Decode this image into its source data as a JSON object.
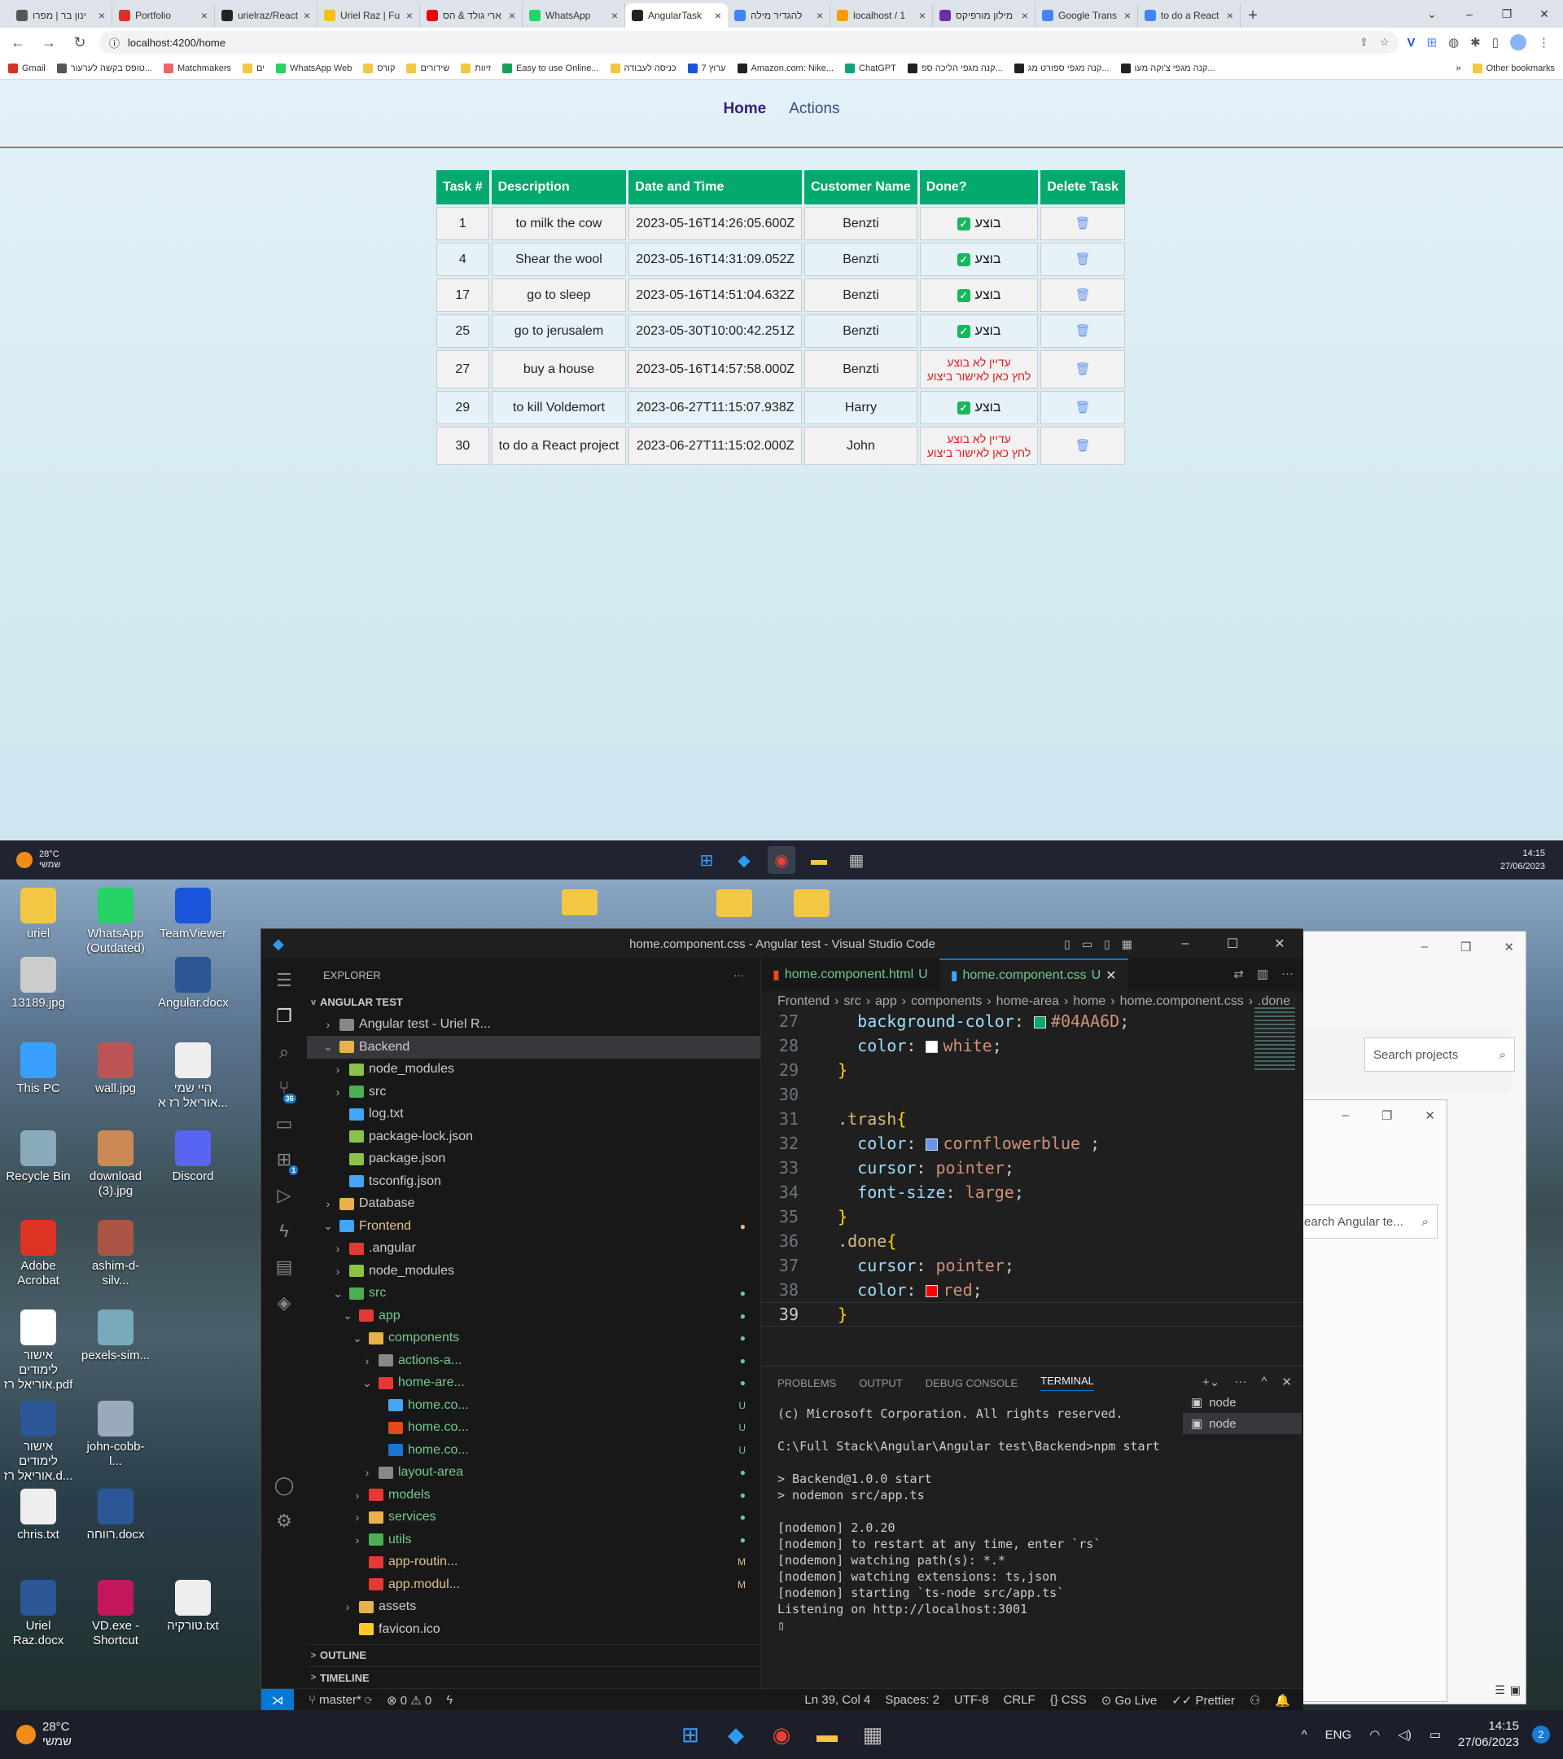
{
  "browser": {
    "tabs": [
      {
        "label": "ינון בר | מפרו",
        "color": "#555"
      },
      {
        "label": "Portfolio",
        "color": "#d93025"
      },
      {
        "label": "urielraz/React",
        "color": "#222"
      },
      {
        "label": "Uriel Raz | Fu",
        "color": "#f4c20d"
      },
      {
        "label": "ארי גולד & הס",
        "color": "#e00"
      },
      {
        "label": "WhatsApp",
        "color": "#25d366"
      },
      {
        "label": "AngularTask",
        "color": "#222",
        "active": true
      },
      {
        "label": "להגדיר מילה",
        "color": "#4285f4"
      },
      {
        "label": "localhost / 1",
        "color": "#f90"
      },
      {
        "label": "מילון מורפיקס",
        "color": "#6b2fa0"
      },
      {
        "label": "Google Trans",
        "color": "#4285f4"
      },
      {
        "label": "to do a React",
        "color": "#4285f4"
      }
    ],
    "new_tab": "+",
    "url": "localhost:4200/home",
    "bookmarks": [
      "Gmail",
      "טופס בקשה לערעור...",
      "Matchmakers",
      "ים",
      "WhatsApp Web",
      "קורס",
      "שידורים",
      "זיוות",
      "Easy to use Online...",
      "כניסה לעבודה",
      "ערוץ 7",
      "Amazon.com: Nike...",
      "ChatGPT",
      "קנה מגפי הליכה ספ...",
      "קנה מגפי ספורט מג...",
      "קנה מגפי צ'וקה מעו..."
    ],
    "bookmarks_more": "»",
    "other_bookmarks": "Other bookmarks"
  },
  "app": {
    "nav": {
      "home": "Home",
      "actions": "Actions"
    },
    "table": {
      "headers": [
        "Task #",
        "Description",
        "Date and Time",
        "Customer Name",
        "Done?",
        "Delete Task"
      ],
      "rows": [
        {
          "id": "1",
          "desc": "to milk the cow",
          "date": "2023-05-16T14:26:05.600Z",
          "customer": "Benzti",
          "done": true
        },
        {
          "id": "4",
          "desc": "Shear the wool",
          "date": "2023-05-16T14:31:09.052Z",
          "customer": "Benzti",
          "done": true
        },
        {
          "id": "17",
          "desc": "go to sleep",
          "date": "2023-05-16T14:51:04.632Z",
          "customer": "Benzti",
          "done": true
        },
        {
          "id": "25",
          "desc": "go to jerusalem",
          "date": "2023-05-30T10:00:42.251Z",
          "customer": "Benzti",
          "done": true
        },
        {
          "id": "27",
          "desc": "buy a house",
          "date": "2023-05-16T14:57:58.000Z",
          "customer": "Benzti",
          "done": false
        },
        {
          "id": "29",
          "desc": "to kill Voldemort",
          "date": "2023-06-27T11:15:07.938Z",
          "customer": "Harry",
          "done": true
        },
        {
          "id": "30",
          "desc": "to do a React project",
          "date": "2023-06-27T11:15:02.000Z",
          "customer": "John",
          "done": false
        }
      ],
      "done_label": "בוצע",
      "not_done_line1": "עדיין לא בוצע",
      "not_done_line2": "לחץ כאן לאישור ביצוע"
    }
  },
  "taskbar_top": {
    "temp": "28°C",
    "weather": "שמשי",
    "time": "14:15",
    "date": "27/06/2023"
  },
  "desktop": {
    "icons": [
      {
        "label": "uriel"
      },
      {
        "label": "WhatsApp (Outdated)"
      },
      {
        "label": "TeamViewer"
      },
      {
        "label": "13189.jpg"
      },
      {
        "label": "Angular.docx"
      },
      {
        "label": "This PC"
      },
      {
        "label": "wall.jpg"
      },
      {
        "label": "היי שמי אוריאל רז א..."
      },
      {
        "label": "Recycle Bin"
      },
      {
        "label": "download (3).jpg"
      },
      {
        "label": "Discord"
      },
      {
        "label": "Adobe Acrobat"
      },
      {
        "label": "ashim-d-silv..."
      },
      {
        "label": "אישור לימודים אוריאל רז.pdf"
      },
      {
        "label": "pexels-sim..."
      },
      {
        "label": "אישור לימודים אוריאל רז.d..."
      },
      {
        "label": "john-cobb-l..."
      },
      {
        "label": "chris.txt"
      },
      {
        "label": "רווחה.docx"
      },
      {
        "label": "Uriel Raz.docx"
      },
      {
        "label": "VD.exe - Shortcut"
      },
      {
        "label": "טורקיה.txt"
      }
    ]
  },
  "vscode": {
    "title": "home.component.css - Angular test - Visual Studio Code",
    "explorer_label": "EXPLORER",
    "source_control_badge": "36",
    "extensions_badge": "1",
    "section": "ANGULAR TEST",
    "tree": [
      {
        "label": "Angular test - Uriel R...",
        "depth": 1,
        "arrow": ">",
        "color": "#888"
      },
      {
        "label": "Backend",
        "depth": 1,
        "arrow": "v",
        "color": "#e8b14a",
        "selected": true
      },
      {
        "label": "node_modules",
        "depth": 2,
        "arrow": ">",
        "color": "#8bc34a"
      },
      {
        "label": "src",
        "depth": 2,
        "arrow": ">",
        "color": "#4caf50"
      },
      {
        "label": "log.txt",
        "depth": 2,
        "arrow": "",
        "color": "#42a5f5"
      },
      {
        "label": "package-lock.json",
        "depth": 2,
        "arrow": "",
        "color": "#8bc34a"
      },
      {
        "label": "package.json",
        "depth": 2,
        "arrow": "",
        "color": "#8bc34a"
      },
      {
        "label": "tsconfig.json",
        "depth": 2,
        "arrow": "",
        "color": "#42a5f5"
      },
      {
        "label": "Database",
        "depth": 1,
        "arrow": ">",
        "color": "#e8b14a"
      },
      {
        "label": "Frontend",
        "depth": 1,
        "arrow": "v",
        "color": "#42a5f5",
        "status": "●",
        "cls": "mod"
      },
      {
        "label": ".angular",
        "depth": 2,
        "arrow": ">",
        "color": "#e53935"
      },
      {
        "label": "node_modules",
        "depth": 2,
        "arrow": ">",
        "color": "#8bc34a"
      },
      {
        "label": "src",
        "depth": 2,
        "arrow": "v",
        "color": "#4caf50",
        "status": "●",
        "cls": "green"
      },
      {
        "label": "app",
        "depth": 3,
        "arrow": "v",
        "color": "#e53935",
        "status": "●",
        "cls": "green"
      },
      {
        "label": "components",
        "depth": 4,
        "arrow": "v",
        "color": "#e8b14a",
        "status": "●",
        "cls": "green"
      },
      {
        "label": "actions-a...",
        "depth": 5,
        "arrow": ">",
        "color": "#888",
        "status": "●",
        "cls": "green"
      },
      {
        "label": "home-are...",
        "depth": 5,
        "arrow": "v",
        "color": "#e53935",
        "status": "●",
        "cls": "green"
      },
      {
        "label": "home.co...",
        "depth": 6,
        "arrow": "",
        "color": "#42a5f5",
        "status": "U",
        "cls": "green"
      },
      {
        "label": "home.co...",
        "depth": 6,
        "arrow": "",
        "color": "#e64a19",
        "status": "U",
        "cls": "green"
      },
      {
        "label": "home.co...",
        "depth": 6,
        "arrow": "",
        "color": "#1976d2",
        "status": "U",
        "cls": "green"
      },
      {
        "label": "layout-area",
        "depth": 5,
        "arrow": ">",
        "color": "#888",
        "status": "●",
        "cls": "green"
      },
      {
        "label": "models",
        "depth": 4,
        "arrow": ">",
        "color": "#e53935",
        "status": "●",
        "cls": "green"
      },
      {
        "label": "services",
        "depth": 4,
        "arrow": ">",
        "color": "#e8b14a",
        "status": "●",
        "cls": "green"
      },
      {
        "label": "utils",
        "depth": 4,
        "arrow": ">",
        "color": "#4caf50",
        "status": "●",
        "cls": "green"
      },
      {
        "label": "app-routin...",
        "depth": 4,
        "arrow": "",
        "color": "#e53935",
        "status": "M",
        "cls": "mod"
      },
      {
        "label": "app.modul...",
        "depth": 4,
        "arrow": "",
        "color": "#e53935",
        "status": "M",
        "cls": "mod"
      },
      {
        "label": "assets",
        "depth": 3,
        "arrow": ">",
        "color": "#e8b14a"
      },
      {
        "label": "favicon.ico",
        "depth": 3,
        "arrow": "",
        "color": "#ffca28"
      }
    ],
    "outline": "OUTLINE",
    "timeline": "TIMELINE",
    "tabs": [
      {
        "label": "home.component.html",
        "status": "U",
        "color": "#e64a19"
      },
      {
        "label": "home.component.css",
        "status": "U",
        "color": "#42a5f5",
        "active": true
      }
    ],
    "breadcrumb": [
      "Frontend",
      "src",
      "app",
      "components",
      "home-area",
      "home",
      "home.component.css",
      ".done"
    ],
    "code": [
      {
        "n": "27",
        "html": "    <span class='prop'>background-color</span><span class='pun'>: </span><span class='sw' style='background:#04AA6D'></span><span class='val'>#04AA6D</span><span class='pun'>;</span>"
      },
      {
        "n": "28",
        "html": "    <span class='prop'>color</span><span class='pun'>: </span><span class='sw' style='background:#fff'></span><span class='val'>white</span><span class='pun'>;</span>"
      },
      {
        "n": "29",
        "html": "  <span class='br'>}</span>"
      },
      {
        "n": "30",
        "html": ""
      },
      {
        "n": "31",
        "html": "  <span class='sel_'>.trash</span><span class='br'>{</span>"
      },
      {
        "n": "32",
        "html": "    <span class='prop'>color</span><span class='pun'>: </span><span class='sw' style='background:cornflowerblue'></span><span class='val'>cornflowerblue</span><span class='pun'> ;</span>"
      },
      {
        "n": "33",
        "html": "    <span class='prop'>cursor</span><span class='pun'>: </span><span class='val'>pointer</span><span class='pun'>;</span>"
      },
      {
        "n": "34",
        "html": "    <span class='prop'>font-size</span><span class='pun'>: </span><span class='val'>large</span><span class='pun'>;</span>"
      },
      {
        "n": "35",
        "html": "  <span class='br'>}</span>"
      },
      {
        "n": "36",
        "html": "  <span class='sel_'>.done</span><span class='br'>{</span>"
      },
      {
        "n": "37",
        "html": "    <span class='prop'>cursor</span><span class='pun'>: </span><span class='val'>pointer</span><span class='pun'>;</span>"
      },
      {
        "n": "38",
        "html": "    <span class='prop'>color</span><span class='pun'>: </span><span class='sw' style='background:red'></span><span class='val'>red</span><span class='pun'>;</span>"
      },
      {
        "n": "39",
        "html": "  <span class='br'>}</span>",
        "cur": true
      }
    ],
    "panel_tabs": [
      "PROBLEMS",
      "OUTPUT",
      "DEBUG CONSOLE",
      "TERMINAL"
    ],
    "terminal": "(c) Microsoft Corporation. All rights reserved.\n\nC:\\Full Stack\\Angular\\Angular test\\Backend>npm start\n\n> Backend@1.0.0 start\n> nodemon src/app.ts\n\n[nodemon] 2.0.20\n[nodemon] to restart at any time, enter `rs`\n[nodemon] watching path(s): *.*\n[nodemon] watching extensions: ts,json\n[nodemon] starting `ts-node src/app.ts`\nListening on http://localhost:3001\n▯",
    "terminals": [
      "node",
      "node"
    ],
    "status": {
      "branch": "master*",
      "errors": "0",
      "warnings": "0",
      "position": "Ln 39, Col 4",
      "spaces": "Spaces: 2",
      "encoding": "UTF-8",
      "eol": "CRLF",
      "lang": "CSS",
      "golive": "Go Live",
      "prettier": "Prettier"
    }
  },
  "bg_windows": {
    "search1": "Search projects",
    "search2": "earch Angular te..."
  },
  "taskbar_bottom": {
    "temp": "28°C",
    "weather": "שמשי",
    "lang": "ENG",
    "time": "14:15",
    "date": "27/06/2023",
    "notif": "2"
  }
}
